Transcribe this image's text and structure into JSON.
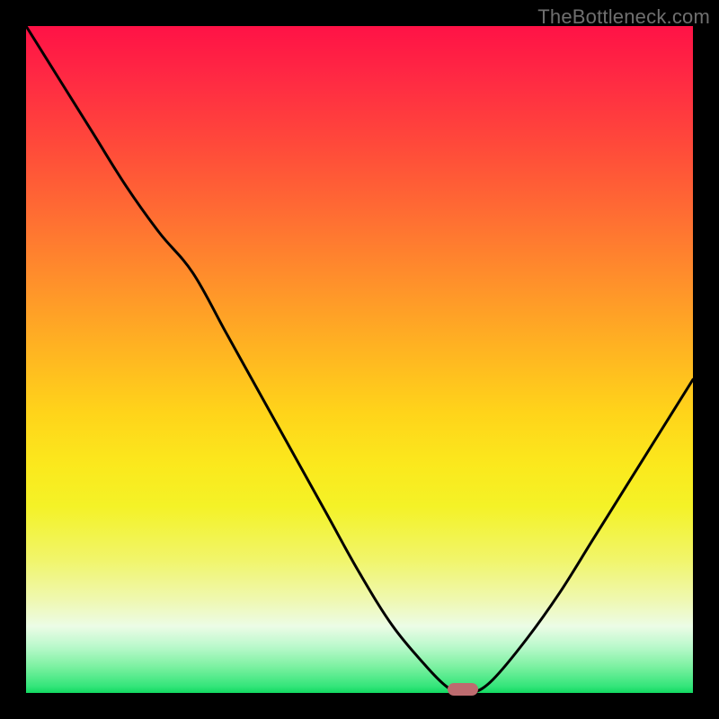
{
  "watermark": "TheBottleneck.com",
  "chart_data": {
    "type": "line",
    "title": "",
    "xlabel": "",
    "ylabel": "",
    "xlim": [
      0,
      100
    ],
    "ylim": [
      0,
      100
    ],
    "categories": [
      0,
      5,
      10,
      15,
      20,
      25,
      30,
      35,
      40,
      45,
      50,
      55,
      60,
      63,
      65,
      67,
      70,
      75,
      80,
      85,
      90,
      95,
      100
    ],
    "series": [
      {
        "name": "bottleneck-curve",
        "values": [
          100,
          92,
          84,
          76,
          69,
          63,
          54,
          45,
          36,
          27,
          18,
          10,
          4,
          1,
          0,
          0,
          2,
          8,
          15,
          23,
          31,
          39,
          47
        ]
      }
    ],
    "marker": {
      "x": 65.5,
      "y": 0.6
    }
  }
}
